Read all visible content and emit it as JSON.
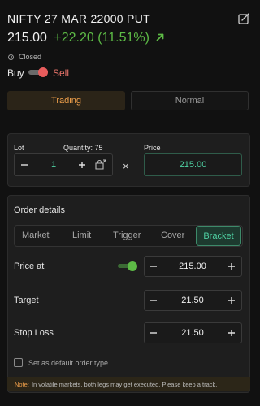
{
  "header": {
    "title": "NIFTY 27 MAR 22000 PUT",
    "ltp_int": "215.",
    "ltp_dec": "00",
    "change": "+22.20 (11.51%)",
    "market_status": "Closed"
  },
  "side_toggle": {
    "buy_label": "Buy",
    "sell_label": "Sell",
    "selected": "Sell"
  },
  "product_tabs": [
    {
      "label": "Trading",
      "active": true
    },
    {
      "label": "Normal",
      "active": false
    }
  ],
  "quantity_section": {
    "lot_label": "Lot",
    "quantity_label": "Quantity: 75",
    "lot_value": "1",
    "multiply_symbol": "×",
    "price_label": "Price",
    "price_value": "215.00"
  },
  "order_details": {
    "title": "Order details",
    "order_types": [
      "Market",
      "Limit",
      "Trigger",
      "Cover",
      "Bracket"
    ],
    "selected_type": "Bracket",
    "price_at": {
      "label": "Price at",
      "value": "215.00",
      "toggle_on": true
    },
    "target": {
      "label": "Target",
      "value": "21.50"
    },
    "stop_loss": {
      "label": "Stop Loss",
      "value": "21.50"
    },
    "default_checkbox_label": "Set as default order type",
    "default_checked": false
  },
  "note": {
    "prefix": "Note:",
    "text": "In volatile markets, both legs may get executed. Please keep a track."
  },
  "colors": {
    "accent_green": "#4fd1a3",
    "positive": "#5dbb46",
    "sell_red": "#e85d5d",
    "trading_orange": "#f0a04b"
  }
}
